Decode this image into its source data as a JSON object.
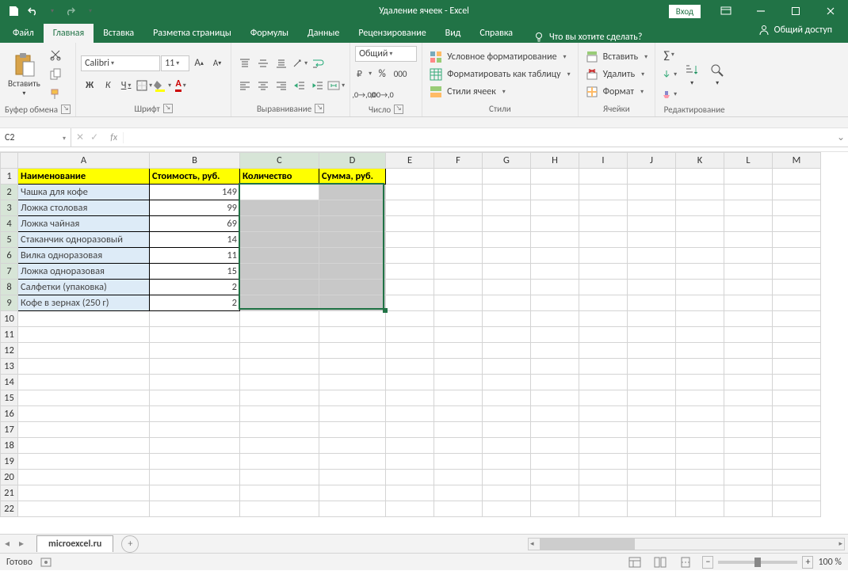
{
  "title": "Удаление ячеек  -  Excel",
  "login": "Вход",
  "tabs": {
    "file": "Файл",
    "home": "Главная",
    "insert": "Вставка",
    "layout": "Разметка страницы",
    "formulas": "Формулы",
    "data": "Данные",
    "review": "Рецензирование",
    "view": "Вид",
    "help": "Справка",
    "tell": "Что вы хотите сделать?",
    "share": "Общий доступ"
  },
  "ribbon": {
    "clipboard": {
      "label": "Буфер обмена",
      "paste": "Вставить"
    },
    "font": {
      "label": "Шрифт",
      "name": "Calibri",
      "size": "11",
      "bold": "Ж",
      "italic": "К",
      "underline": "Ч"
    },
    "align": {
      "label": "Выравнивание"
    },
    "number": {
      "label": "Число",
      "format": "Общий"
    },
    "styles": {
      "label": "Стили",
      "cond": "Условное форматирование",
      "table": "Форматировать как таблицу",
      "cell": "Стили ячеек"
    },
    "cells": {
      "label": "Ячейки",
      "insert": "Вставить",
      "delete": "Удалить",
      "format": "Формат"
    },
    "editing": {
      "label": "Редактирование"
    }
  },
  "namebox": "C2",
  "formula": "",
  "columns": [
    "A",
    "B",
    "C",
    "D",
    "E",
    "F",
    "G",
    "H",
    "I",
    "J",
    "K",
    "L",
    "M"
  ],
  "rows": [
    "1",
    "2",
    "3",
    "4",
    "5",
    "6",
    "7",
    "8",
    "9",
    "10",
    "11",
    "12",
    "13",
    "14",
    "15",
    "16",
    "17",
    "18",
    "19",
    "20",
    "21",
    "22"
  ],
  "headers": {
    "a": "Наименование",
    "b": "Стоимость, руб.",
    "c": "Количество",
    "d": "Сумма, руб."
  },
  "data": [
    {
      "name": "Чашка для кофе",
      "price": "149"
    },
    {
      "name": "Ложка столовая",
      "price": "99"
    },
    {
      "name": "Ложка чайная",
      "price": "69"
    },
    {
      "name": "Стаканчик одноразовый",
      "price": "14"
    },
    {
      "name": "Вилка одноразовая",
      "price": "11"
    },
    {
      "name": "Ложка одноразовая",
      "price": "15"
    },
    {
      "name": "Салфетки (упаковка)",
      "price": "2"
    },
    {
      "name": "Кофе в зернах (250 г)",
      "price": "2"
    }
  ],
  "sheet_tab": "microexcel.ru",
  "status": "Готово",
  "zoom": "100 %"
}
